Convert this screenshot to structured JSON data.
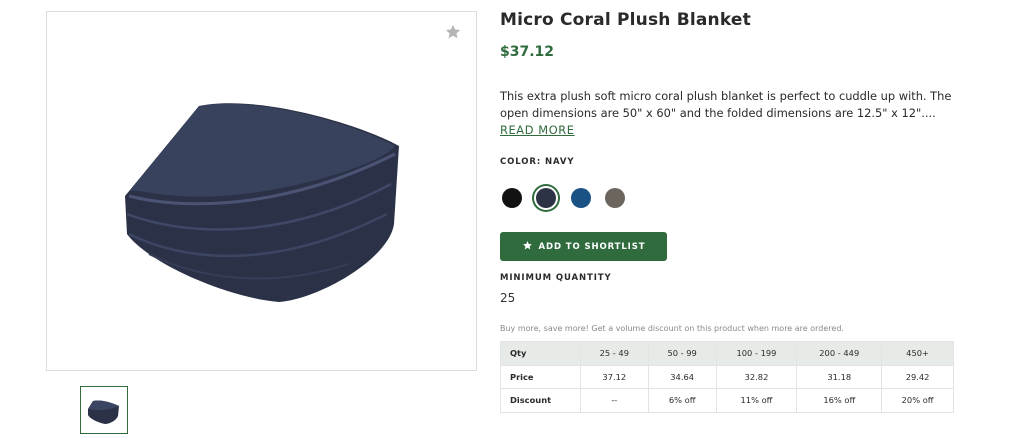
{
  "product": {
    "title": "Micro Coral Plush Blanket",
    "price": "$37.12",
    "description": "This extra plush soft micro coral plush blanket is perfect to cuddle up with. The open dimensions are 50\" x 60\" and the folded dimensions are 12.5\" x 12\"....",
    "read_more": "READ MORE",
    "favorite_icon": "star-icon"
  },
  "colors": {
    "label": "COLOR: NAVY",
    "swatches": [
      {
        "name": "black",
        "hex": "#121212"
      },
      {
        "name": "navy",
        "hex": "#2c3344",
        "selected": true
      },
      {
        "name": "royal-blue",
        "hex": "#1b5286"
      },
      {
        "name": "charcoal",
        "hex": "#6b655d"
      }
    ]
  },
  "actions": {
    "shortlist_label": "ADD TO SHORTLIST",
    "shortlist_icon": "star-icon"
  },
  "minimum_quantity": {
    "label": "MINIMUM QUANTITY",
    "value": "25"
  },
  "volume_discount": {
    "note": "Buy more, save more! Get a volume discount on this product when more are ordered.",
    "headers": [
      "Qty",
      "25 - 49",
      "50 - 99",
      "100 - 199",
      "200 - 449",
      "450+"
    ],
    "rows": [
      [
        "Price",
        "37.12",
        "34.64",
        "32.82",
        "31.18",
        "29.42"
      ],
      [
        "Discount",
        "--",
        "6% off",
        "11% off",
        "16% off",
        "20% off"
      ]
    ]
  },
  "theme": {
    "accent": "#2f6b3d",
    "table_header_bg": "#e6ebe8"
  }
}
